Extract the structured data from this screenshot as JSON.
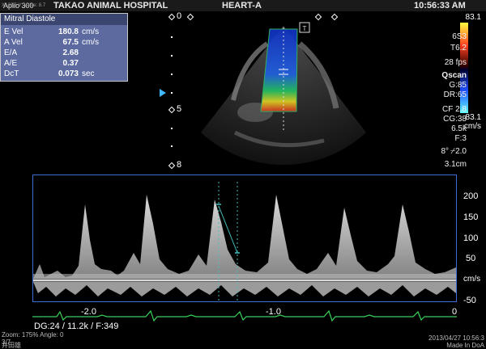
{
  "header": {
    "system": "Aplio 300",
    "hospital": "TAKAO ANIMAL HOSPITAL",
    "exam": "HEART-A",
    "time": "10:56:33 AM",
    "overlay_hint": "X: 22.5 Y: Value: 8.7"
  },
  "measurements": {
    "title": "Mitral Diastole",
    "rows": [
      {
        "label": "E Vel",
        "value": "180.8",
        "unit": "cm/s"
      },
      {
        "label": "A Vel",
        "value": "67.5",
        "unit": "cm/s"
      },
      {
        "label": "E/A",
        "value": "2.68",
        "unit": ""
      },
      {
        "label": "A/E",
        "value": "0.37",
        "unit": ""
      },
      {
        "label": "DcT",
        "value": "0.073",
        "unit": "sec"
      }
    ]
  },
  "depth_scale": {
    "d0": "0",
    "d5": "5",
    "d8": "8"
  },
  "params": {
    "color_top": "83.1",
    "probe": "6S3",
    "freq": "T6.2",
    "fps": "28 fps",
    "mode": "Qscan",
    "gain": "G:85",
    "dr": "DR:65",
    "cf": "CF 2.8",
    "cg": "CG:38",
    "khz": "6.5k",
    "f": "F:3",
    "angle": "8°",
    "sample": "⌿2.0",
    "depth": "3.1cm",
    "color_bottom": "83.1",
    "color_unit": "cm/s"
  },
  "velocity_scale": {
    "labels": [
      "200",
      "150",
      "100",
      "50",
      "cm/s",
      "-50"
    ]
  },
  "time_scale": {
    "labels": [
      "-2.0",
      "-1.0",
      "0"
    ]
  },
  "bottom": {
    "doppler_info": "DG:24  / 11.2k  / F:349",
    "zoom": "Zoom: 175%  Angle: 0",
    "frame": "3/7",
    "patient": "井田雄",
    "date": "2013/04/27 10:56:3",
    "made_in": "Made In DoA"
  },
  "colors": {
    "accent_blue": "#3f6ed8",
    "ecg_green": "#38d05a",
    "panel": "#5c6aa0"
  }
}
